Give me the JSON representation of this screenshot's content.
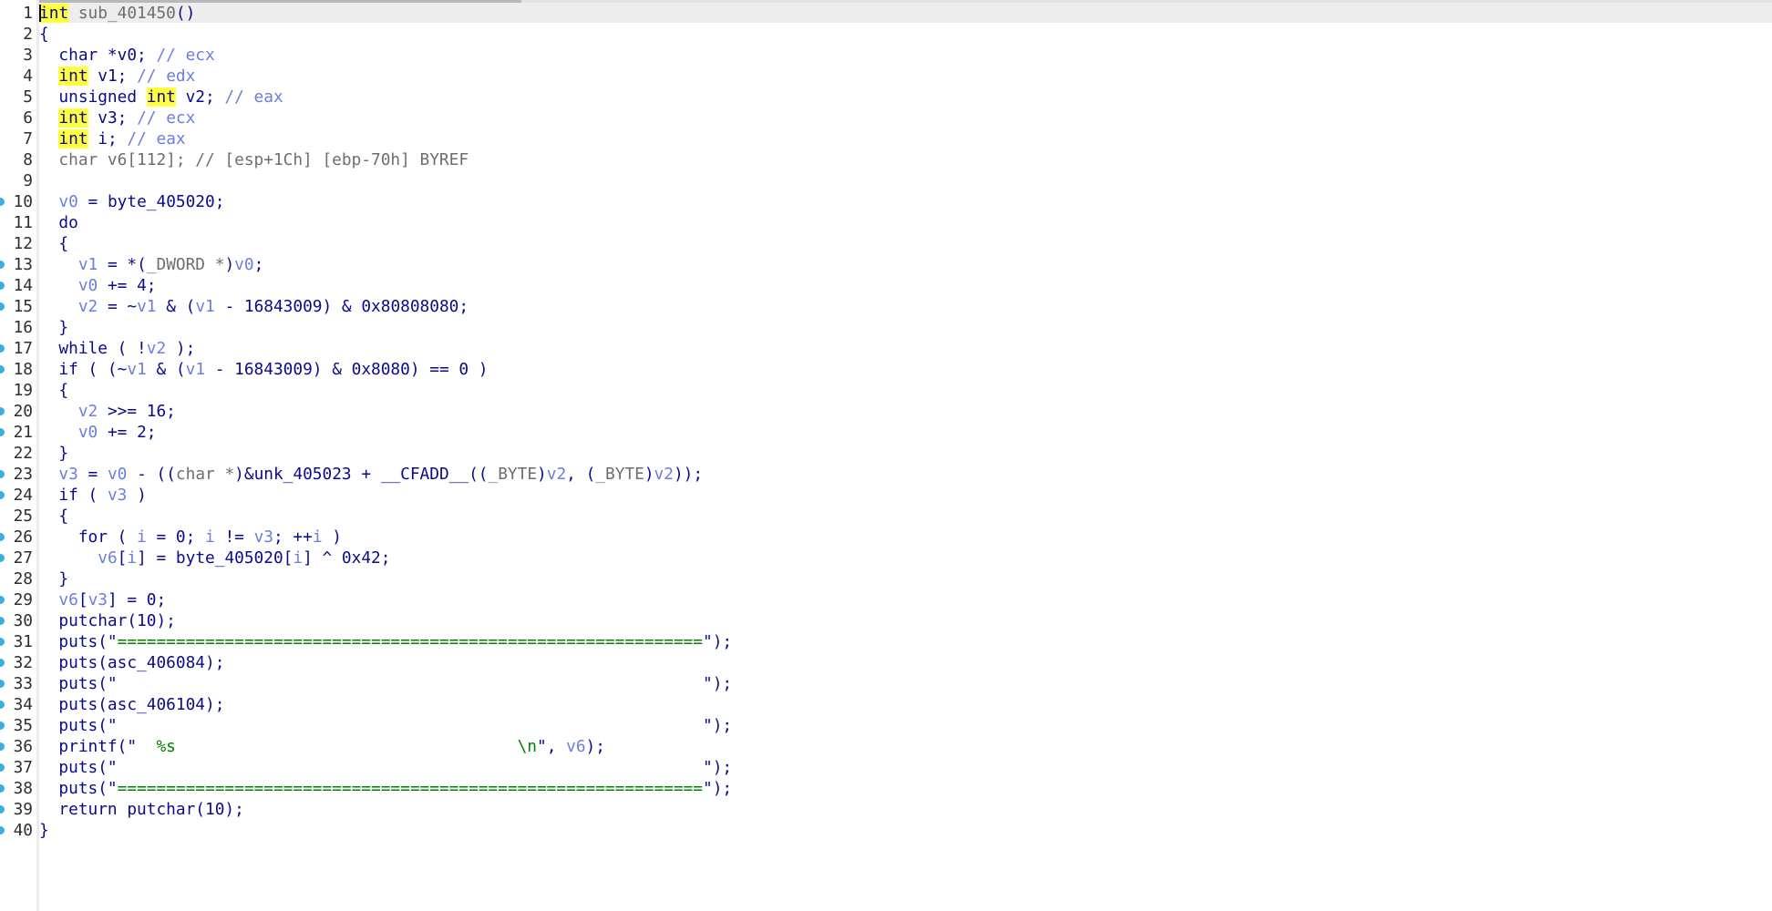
{
  "editor": {
    "function_name": "sub_401450",
    "cursor_line": 1,
    "lines": [
      {
        "num": "1",
        "dot": false,
        "tokens": [
          {
            "t": "int",
            "c": "kw hl"
          },
          {
            "t": " sub_401450",
            "c": "typ"
          },
          {
            "t": "()",
            "c": "op"
          }
        ]
      },
      {
        "num": "2",
        "dot": false,
        "tokens": [
          {
            "t": "{",
            "c": "op"
          }
        ]
      },
      {
        "num": "3",
        "dot": false,
        "tokens": [
          {
            "t": "  char *v0; ",
            "c": "kw"
          },
          {
            "t": "// ecx",
            "c": "cmt"
          }
        ]
      },
      {
        "num": "4",
        "dot": false,
        "tokens": [
          {
            "t": "  ",
            "c": "kw"
          },
          {
            "t": "int",
            "c": "kw hl"
          },
          {
            "t": " v1; ",
            "c": "kw"
          },
          {
            "t": "// edx",
            "c": "cmt"
          }
        ]
      },
      {
        "num": "5",
        "dot": false,
        "tokens": [
          {
            "t": "  unsigned ",
            "c": "kw"
          },
          {
            "t": "int",
            "c": "kw hl"
          },
          {
            "t": " v2; ",
            "c": "kw"
          },
          {
            "t": "// eax",
            "c": "cmt"
          }
        ]
      },
      {
        "num": "6",
        "dot": false,
        "tokens": [
          {
            "t": "  ",
            "c": "kw"
          },
          {
            "t": "int",
            "c": "kw hl"
          },
          {
            "t": " v3; ",
            "c": "kw"
          },
          {
            "t": "// ecx",
            "c": "cmt"
          }
        ]
      },
      {
        "num": "7",
        "dot": false,
        "tokens": [
          {
            "t": "  ",
            "c": "kw"
          },
          {
            "t": "int",
            "c": "kw hl"
          },
          {
            "t": " i; ",
            "c": "kw"
          },
          {
            "t": "// eax",
            "c": "cmt"
          }
        ]
      },
      {
        "num": "8",
        "dot": false,
        "tokens": [
          {
            "t": "  char v6[112]; ",
            "c": "gray"
          },
          {
            "t": "// [esp+1Ch] [ebp-70h] BYREF",
            "c": "gray"
          }
        ]
      },
      {
        "num": "9",
        "dot": false,
        "tokens": []
      },
      {
        "num": "10",
        "dot": true,
        "tokens": [
          {
            "t": "  ",
            "c": "kw"
          },
          {
            "t": "v0",
            "c": "var"
          },
          {
            "t": " = byte_405020;",
            "c": "kw"
          }
        ]
      },
      {
        "num": "11",
        "dot": false,
        "tokens": [
          {
            "t": "  do",
            "c": "kw"
          }
        ]
      },
      {
        "num": "12",
        "dot": false,
        "tokens": [
          {
            "t": "  {",
            "c": "kw"
          }
        ]
      },
      {
        "num": "13",
        "dot": true,
        "tokens": [
          {
            "t": "    ",
            "c": "kw"
          },
          {
            "t": "v1",
            "c": "var"
          },
          {
            "t": " = *(",
            "c": "kw"
          },
          {
            "t": "_DWORD *",
            "c": "typ"
          },
          {
            "t": ")",
            "c": "kw"
          },
          {
            "t": "v0",
            "c": "var"
          },
          {
            "t": ";",
            "c": "kw"
          }
        ]
      },
      {
        "num": "14",
        "dot": true,
        "tokens": [
          {
            "t": "    ",
            "c": "kw"
          },
          {
            "t": "v0",
            "c": "var"
          },
          {
            "t": " += 4;",
            "c": "kw"
          }
        ]
      },
      {
        "num": "15",
        "dot": true,
        "tokens": [
          {
            "t": "    ",
            "c": "kw"
          },
          {
            "t": "v2",
            "c": "var"
          },
          {
            "t": " = ~",
            "c": "kw"
          },
          {
            "t": "v1",
            "c": "var"
          },
          {
            "t": " & (",
            "c": "kw"
          },
          {
            "t": "v1",
            "c": "var"
          },
          {
            "t": " - 16843009) & 0x80808080;",
            "c": "kw"
          }
        ]
      },
      {
        "num": "16",
        "dot": false,
        "tokens": [
          {
            "t": "  }",
            "c": "kw"
          }
        ]
      },
      {
        "num": "17",
        "dot": true,
        "tokens": [
          {
            "t": "  while ( !",
            "c": "kw"
          },
          {
            "t": "v2",
            "c": "var"
          },
          {
            "t": " );",
            "c": "kw"
          }
        ]
      },
      {
        "num": "18",
        "dot": true,
        "tokens": [
          {
            "t": "  if ( (~",
            "c": "kw"
          },
          {
            "t": "v1",
            "c": "var"
          },
          {
            "t": " & (",
            "c": "kw"
          },
          {
            "t": "v1",
            "c": "var"
          },
          {
            "t": " - 16843009) & 0x8080) == 0 )",
            "c": "kw"
          }
        ]
      },
      {
        "num": "19",
        "dot": false,
        "tokens": [
          {
            "t": "  {",
            "c": "kw"
          }
        ]
      },
      {
        "num": "20",
        "dot": true,
        "tokens": [
          {
            "t": "    ",
            "c": "kw"
          },
          {
            "t": "v2",
            "c": "var"
          },
          {
            "t": " >>= 16;",
            "c": "kw"
          }
        ]
      },
      {
        "num": "21",
        "dot": true,
        "tokens": [
          {
            "t": "    ",
            "c": "kw"
          },
          {
            "t": "v0",
            "c": "var"
          },
          {
            "t": " += 2;",
            "c": "kw"
          }
        ]
      },
      {
        "num": "22",
        "dot": false,
        "tokens": [
          {
            "t": "  }",
            "c": "kw"
          }
        ]
      },
      {
        "num": "23",
        "dot": true,
        "tokens": [
          {
            "t": "  ",
            "c": "kw"
          },
          {
            "t": "v3",
            "c": "var"
          },
          {
            "t": " = ",
            "c": "kw"
          },
          {
            "t": "v0",
            "c": "var"
          },
          {
            "t": " - ((",
            "c": "kw"
          },
          {
            "t": "char *",
            "c": "typ"
          },
          {
            "t": ")&unk_405023 + __CFADD__((",
            "c": "kw"
          },
          {
            "t": "_BYTE",
            "c": "typ"
          },
          {
            "t": ")",
            "c": "kw"
          },
          {
            "t": "v2",
            "c": "var"
          },
          {
            "t": ", (",
            "c": "kw"
          },
          {
            "t": "_BYTE",
            "c": "typ"
          },
          {
            "t": ")",
            "c": "kw"
          },
          {
            "t": "v2",
            "c": "var"
          },
          {
            "t": "));",
            "c": "kw"
          }
        ]
      },
      {
        "num": "24",
        "dot": true,
        "tokens": [
          {
            "t": "  if ( ",
            "c": "kw"
          },
          {
            "t": "v3",
            "c": "var"
          },
          {
            "t": " )",
            "c": "kw"
          }
        ]
      },
      {
        "num": "25",
        "dot": false,
        "tokens": [
          {
            "t": "  {",
            "c": "kw"
          }
        ]
      },
      {
        "num": "26",
        "dot": true,
        "tokens": [
          {
            "t": "    for ( ",
            "c": "kw"
          },
          {
            "t": "i",
            "c": "var"
          },
          {
            "t": " = 0; ",
            "c": "kw"
          },
          {
            "t": "i",
            "c": "var"
          },
          {
            "t": " != ",
            "c": "kw"
          },
          {
            "t": "v3",
            "c": "var"
          },
          {
            "t": "; ++",
            "c": "kw"
          },
          {
            "t": "i",
            "c": "var"
          },
          {
            "t": " )",
            "c": "kw"
          }
        ]
      },
      {
        "num": "27",
        "dot": true,
        "tokens": [
          {
            "t": "      ",
            "c": "kw"
          },
          {
            "t": "v6",
            "c": "var"
          },
          {
            "t": "[",
            "c": "kw"
          },
          {
            "t": "i",
            "c": "var"
          },
          {
            "t": "] = byte_405020[",
            "c": "kw"
          },
          {
            "t": "i",
            "c": "var"
          },
          {
            "t": "] ^ 0x42;",
            "c": "kw"
          }
        ]
      },
      {
        "num": "28",
        "dot": false,
        "tokens": [
          {
            "t": "  }",
            "c": "kw"
          }
        ]
      },
      {
        "num": "29",
        "dot": true,
        "tokens": [
          {
            "t": "  ",
            "c": "kw"
          },
          {
            "t": "v6",
            "c": "var"
          },
          {
            "t": "[",
            "c": "kw"
          },
          {
            "t": "v3",
            "c": "var"
          },
          {
            "t": "] = 0;",
            "c": "kw"
          }
        ]
      },
      {
        "num": "30",
        "dot": true,
        "tokens": [
          {
            "t": "  putchar(10);",
            "c": "kw"
          }
        ]
      },
      {
        "num": "31",
        "dot": true,
        "tokens": [
          {
            "t": "  puts(\"",
            "c": "kw"
          },
          {
            "t": "============================================================",
            "c": "str"
          },
          {
            "t": "\");",
            "c": "kw"
          }
        ]
      },
      {
        "num": "32",
        "dot": true,
        "tokens": [
          {
            "t": "  puts(asc_406084);",
            "c": "kw"
          }
        ]
      },
      {
        "num": "33",
        "dot": true,
        "tokens": [
          {
            "t": "  puts(\"",
            "c": "kw"
          },
          {
            "t": "                                                            ",
            "c": "str"
          },
          {
            "t": "\");",
            "c": "kw"
          }
        ]
      },
      {
        "num": "34",
        "dot": true,
        "tokens": [
          {
            "t": "  puts(asc_406104);",
            "c": "kw"
          }
        ]
      },
      {
        "num": "35",
        "dot": true,
        "tokens": [
          {
            "t": "  puts(\"",
            "c": "kw"
          },
          {
            "t": "                                                            ",
            "c": "str"
          },
          {
            "t": "\");",
            "c": "kw"
          }
        ]
      },
      {
        "num": "36",
        "dot": true,
        "tokens": [
          {
            "t": "  printf(\"",
            "c": "kw"
          },
          {
            "t": "  %s                                   \\n",
            "c": "str"
          },
          {
            "t": "\", ",
            "c": "kw"
          },
          {
            "t": "v6",
            "c": "var"
          },
          {
            "t": ");",
            "c": "kw"
          }
        ]
      },
      {
        "num": "37",
        "dot": true,
        "tokens": [
          {
            "t": "  puts(\"",
            "c": "kw"
          },
          {
            "t": "                                                            ",
            "c": "str"
          },
          {
            "t": "\");",
            "c": "kw"
          }
        ]
      },
      {
        "num": "38",
        "dot": true,
        "tokens": [
          {
            "t": "  puts(\"",
            "c": "kw"
          },
          {
            "t": "============================================================",
            "c": "str"
          },
          {
            "t": "\");",
            "c": "kw"
          }
        ]
      },
      {
        "num": "39",
        "dot": true,
        "tokens": [
          {
            "t": "  return putchar(10);",
            "c": "kw"
          }
        ]
      },
      {
        "num": "40",
        "dot": true,
        "tokens": [
          {
            "t": "}",
            "c": "kw"
          }
        ]
      }
    ]
  }
}
